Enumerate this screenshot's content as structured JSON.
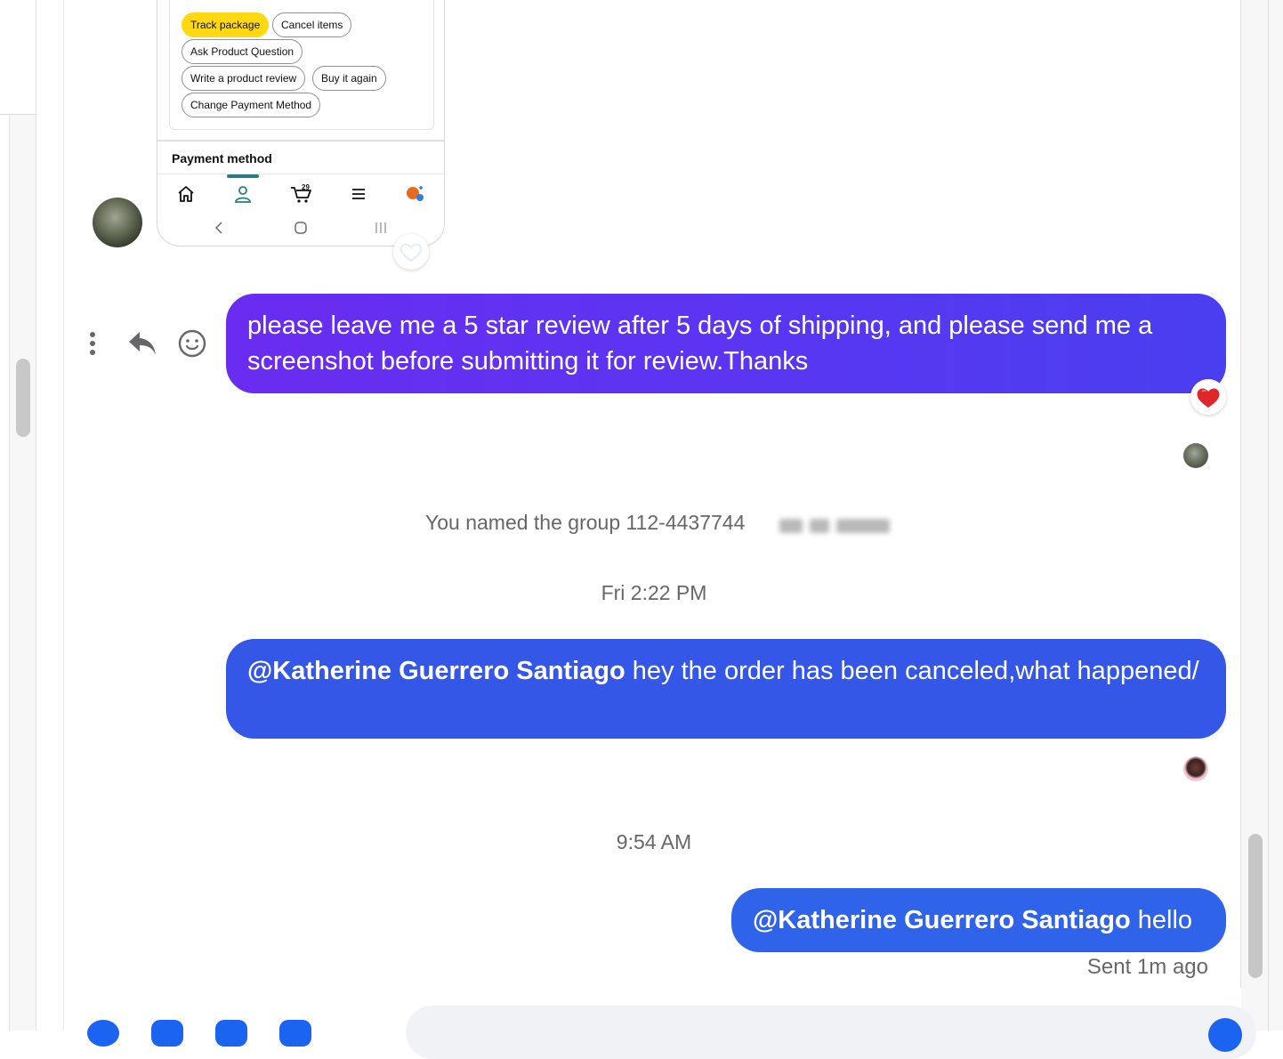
{
  "attachment": {
    "chips": [
      {
        "label": "Track package",
        "primary": true
      },
      {
        "label": "Cancel items",
        "primary": false
      },
      {
        "label": "Ask Product Question",
        "primary": false
      },
      {
        "label": "Write a product review",
        "primary": false
      },
      {
        "label": "Buy it again",
        "primary": false
      },
      {
        "label": "Change Payment Method",
        "primary": false
      }
    ],
    "payment_method_heading": "Payment method",
    "cart_count": "29",
    "nav_icons": [
      "home-icon",
      "account-icon",
      "cart-icon",
      "menu-icon",
      "rufus-icon"
    ],
    "system_nav_icons": [
      "back-icon",
      "home-circle-icon",
      "recents-icon"
    ]
  },
  "messages": [
    {
      "text": "please leave me a 5 star review after 5 days of shipping, and please send me a screenshot before submitting it for review.Thanks",
      "reaction": "heart"
    },
    {
      "mention": "@Katherine Guerrero Santiago",
      "text": " hey the order has been canceled,what happened/"
    },
    {
      "mention": "@Katherine Guerrero Santiago",
      "text": " hello",
      "status": "Sent 1m ago"
    }
  ],
  "system": {
    "group_named": "You named the group 112-4437744"
  },
  "timestamps": {
    "first": "Fri 2:22 PM",
    "second": "9:54 AM"
  },
  "colors": {
    "bubble_blue": "#3457e8",
    "bubble_purple": "#6a2cf0",
    "accent": "#1b64f2",
    "amazon_yellow": "#ffd814",
    "amazon_teal": "#2a7c84"
  }
}
